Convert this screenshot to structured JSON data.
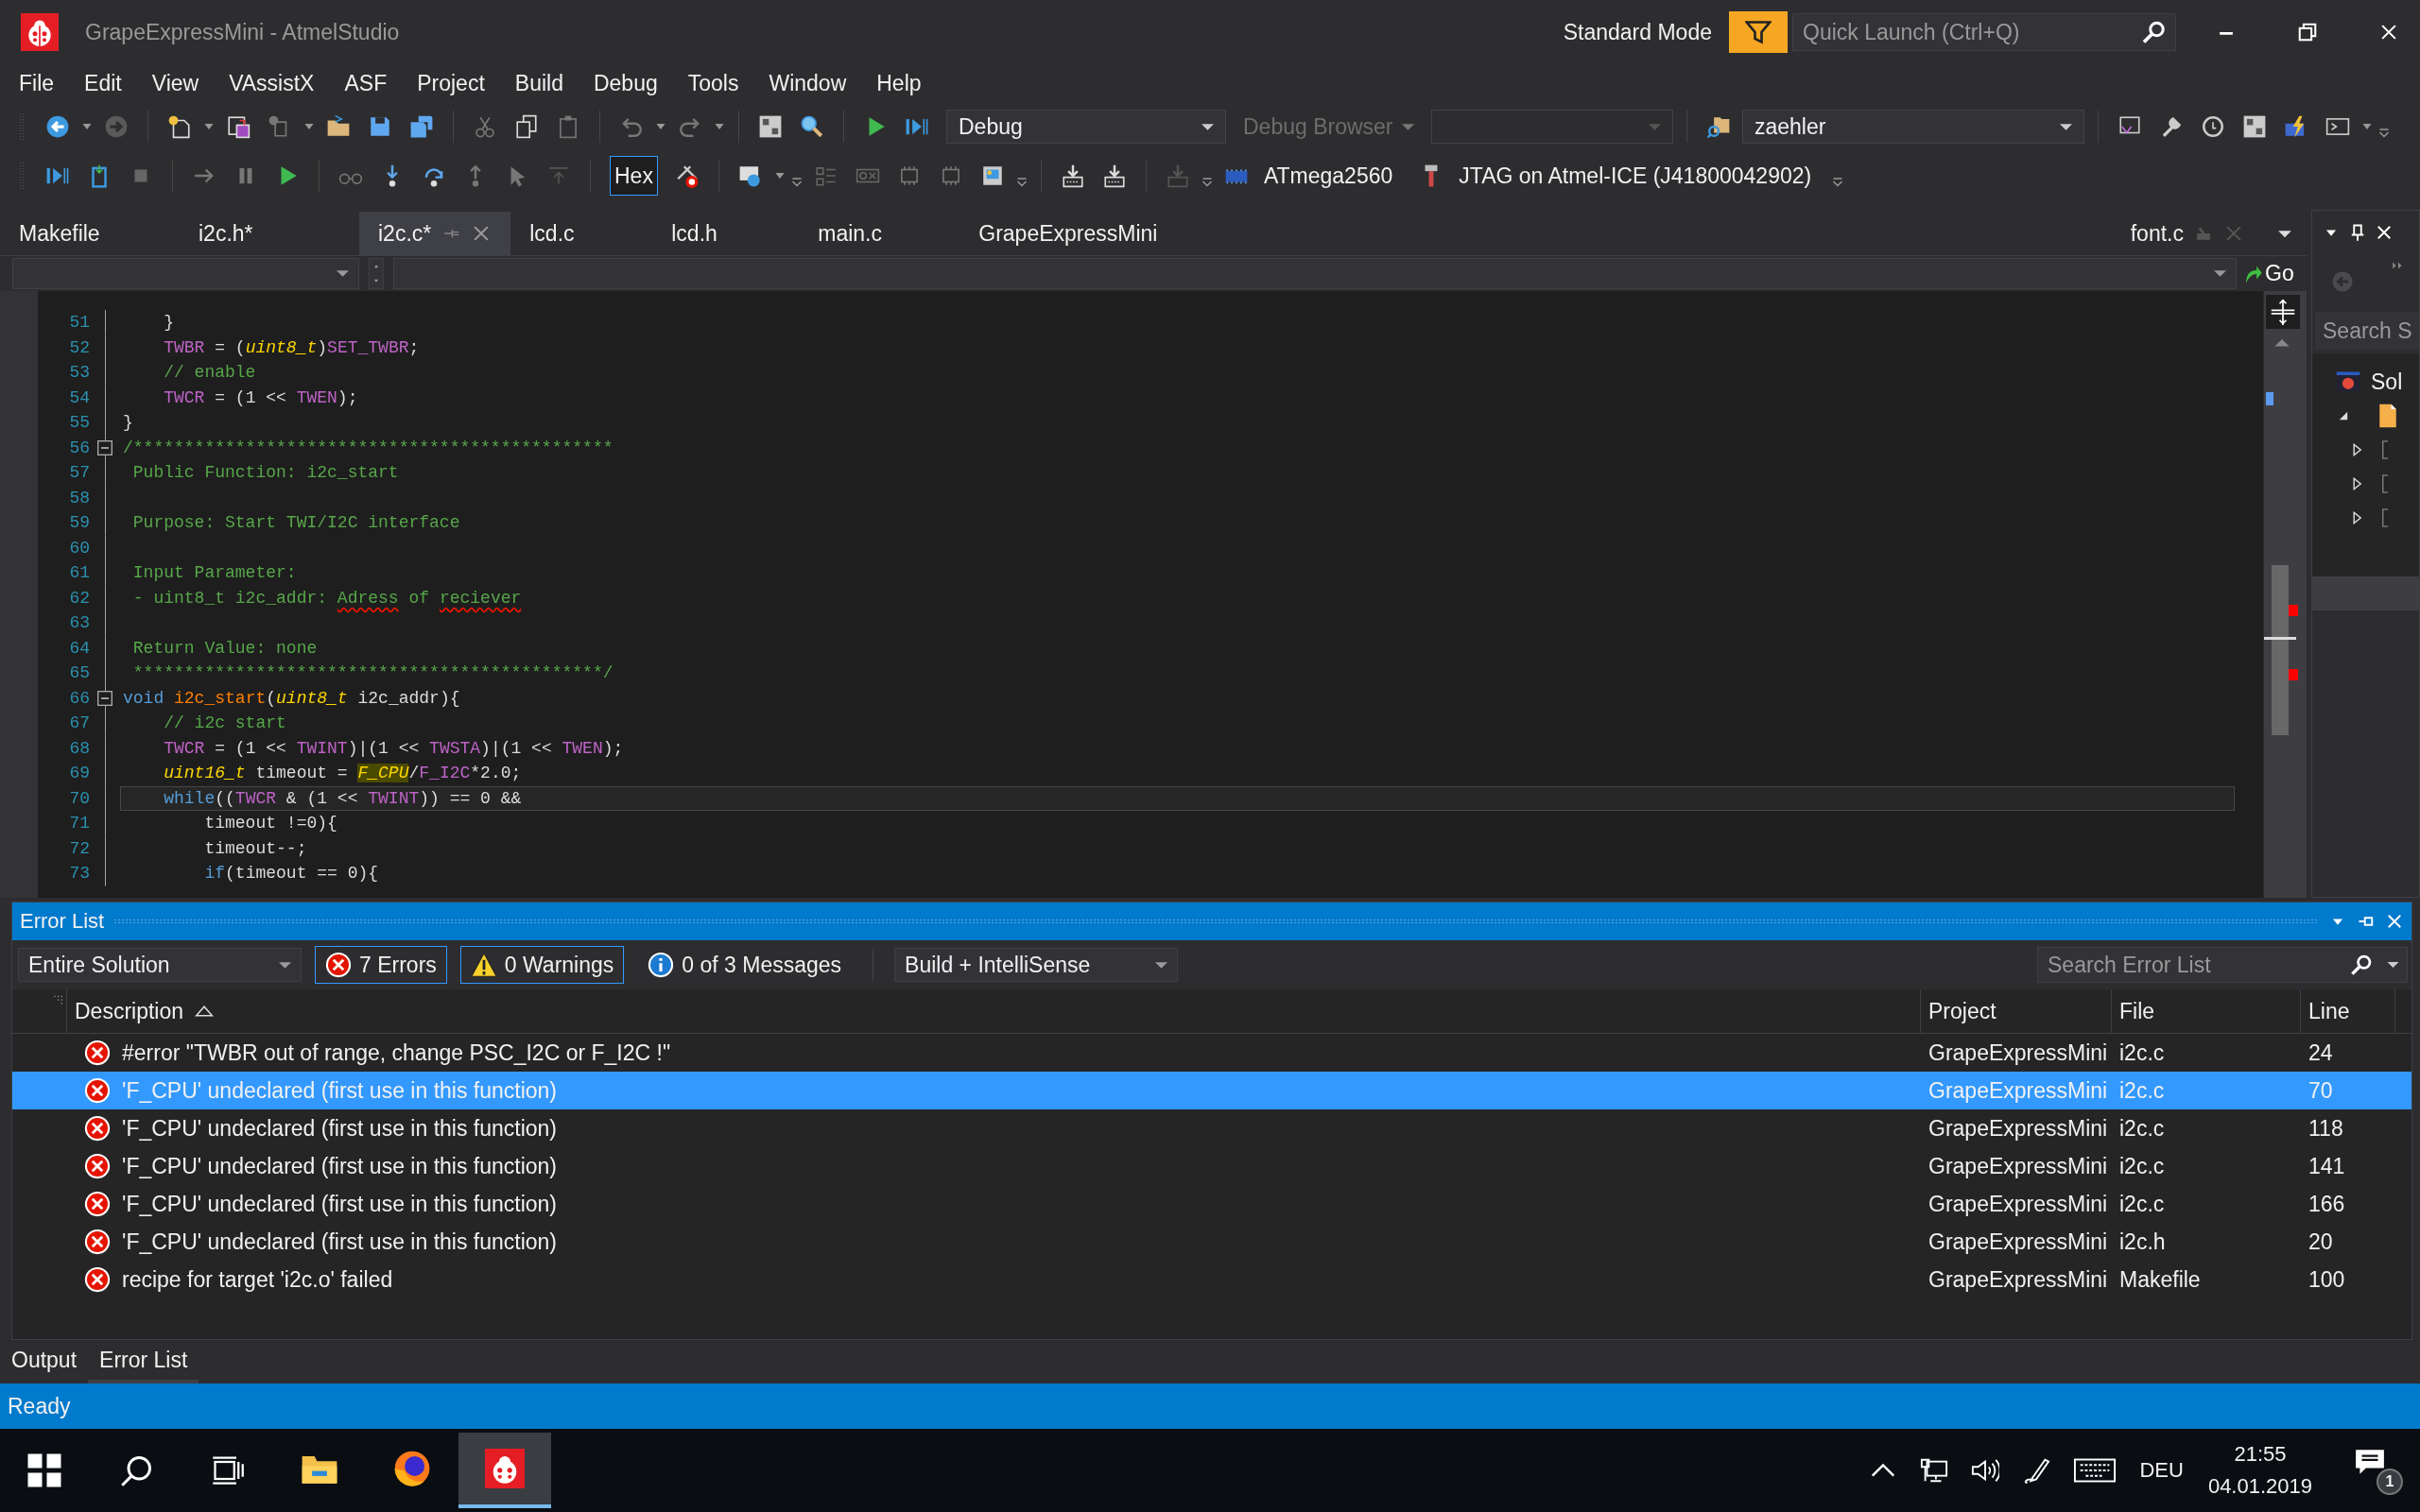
{
  "window": {
    "title": "GrapeExpressMini - AtmelStudio",
    "mode": "Standard Mode",
    "quick_launch": {
      "placeholder": "Quick Launch (Ctrl+Q)"
    }
  },
  "menu": [
    "File",
    "Edit",
    "View",
    "VAssistX",
    "ASF",
    "Project",
    "Build",
    "Debug",
    "Tools",
    "Window",
    "Help"
  ],
  "toolbar": {
    "configuration": "Debug",
    "debug_browser": {
      "label": "Debug Browser",
      "disabled": true
    },
    "project": "zaehler",
    "hex": {
      "label": "Hex",
      "on": true
    },
    "device": "ATmega2560",
    "tool": "JTAG on Atmel-ICE (J41800042902)"
  },
  "tabs": [
    {
      "label": "Makefile",
      "kind": "document",
      "selected": false
    },
    {
      "label": "i2c.h*",
      "kind": "document",
      "selected": false
    },
    {
      "label": "i2c.c*",
      "kind": "document",
      "selected": true
    },
    {
      "label": "lcd.c",
      "kind": "document",
      "selected": false
    },
    {
      "label": "lcd.h",
      "kind": "document",
      "selected": false
    },
    {
      "label": "main.c",
      "kind": "document",
      "selected": false
    },
    {
      "label": "GrapeExpressMini",
      "kind": "document",
      "selected": false
    },
    {
      "label": "font.c",
      "kind": "preview",
      "selected": false
    }
  ],
  "editor": {
    "go_button": "Go",
    "lines": [
      {
        "number": "51",
        "tokens": [
          {
            "kind": "plain",
            "text": "    }"
          }
        ]
      },
      {
        "number": "52",
        "tokens": [
          {
            "kind": "macro",
            "text": "    TWBR"
          },
          {
            "kind": "plain",
            "text": " = ("
          },
          {
            "kind": "type",
            "text": "uint8_t"
          },
          {
            "kind": "plain",
            "text": ")"
          },
          {
            "kind": "macro",
            "text": "SET_TWBR"
          },
          {
            "kind": "plain",
            "text": ";"
          }
        ]
      },
      {
        "number": "53",
        "tokens": [
          {
            "kind": "comment",
            "text": "    // enable"
          }
        ]
      },
      {
        "number": "54",
        "tokens": [
          {
            "kind": "macro",
            "text": "    TWCR"
          },
          {
            "kind": "plain",
            "text": " = (1 << "
          },
          {
            "kind": "macro",
            "text": "TWEN"
          },
          {
            "kind": "plain",
            "text": ");"
          }
        ]
      },
      {
        "number": "55",
        "tokens": [
          {
            "kind": "plain",
            "text": "}"
          }
        ]
      },
      {
        "number": "56",
        "fold": true,
        "tokens": [
          {
            "kind": "comment",
            "text": "/***********************************************"
          }
        ]
      },
      {
        "number": "57",
        "tokens": [
          {
            "kind": "comment",
            "text": " Public Function: i2c_start"
          }
        ]
      },
      {
        "number": "58"
      },
      {
        "number": "59",
        "tokens": [
          {
            "kind": "comment",
            "text": " Purpose: Start TWI/I2C interface"
          }
        ]
      },
      {
        "number": "60"
      },
      {
        "number": "61",
        "tokens": [
          {
            "kind": "comment",
            "text": " Input Parameter:"
          }
        ]
      },
      {
        "number": "62",
        "tokens": [
          {
            "kind": "comment",
            "text": " - uint8_t i2c_addr: "
          },
          {
            "kind": "misspelled",
            "text": "Adress"
          },
          {
            "kind": "comment",
            "text": " of "
          },
          {
            "kind": "misspelled",
            "text": "reciever"
          }
        ]
      },
      {
        "number": "63"
      },
      {
        "number": "64",
        "tokens": [
          {
            "kind": "comment",
            "text": " Return Value: none"
          }
        ]
      },
      {
        "number": "65",
        "tokens": [
          {
            "kind": "comment",
            "text": " **********************************************/"
          }
        ]
      },
      {
        "number": "66",
        "fold": true,
        "tokens": [
          {
            "kind": "keyword",
            "text": "void"
          },
          {
            "kind": "function",
            "text": " i2c_start"
          },
          {
            "kind": "plain",
            "text": "("
          },
          {
            "kind": "type",
            "text": "uint8_t"
          },
          {
            "kind": "plain",
            "text": " i2c_addr){"
          }
        ]
      },
      {
        "number": "67",
        "tokens": [
          {
            "kind": "comment",
            "text": "    // i2c start"
          }
        ]
      },
      {
        "number": "68",
        "tokens": [
          {
            "kind": "macro",
            "text": "    TWCR"
          },
          {
            "kind": "plain",
            "text": " = (1 << "
          },
          {
            "kind": "macro",
            "text": "TWINT"
          },
          {
            "kind": "plain",
            "text": ")|(1 << "
          },
          {
            "kind": "macro",
            "text": "TWSTA"
          },
          {
            "kind": "plain",
            "text": ")|(1 << "
          },
          {
            "kind": "macro",
            "text": "TWEN"
          },
          {
            "kind": "plain",
            "text": ");"
          }
        ]
      },
      {
        "number": "69",
        "tokens": [
          {
            "kind": "type",
            "text": "    uint16_t"
          },
          {
            "kind": "plain",
            "text": " timeout = "
          },
          {
            "kind": "highlight",
            "text": "F_CPU"
          },
          {
            "kind": "plain",
            "text": "/"
          },
          {
            "kind": "macro",
            "text": "F_I2C"
          },
          {
            "kind": "plain",
            "text": "*2.0;"
          }
        ]
      },
      {
        "number": "70",
        "current": true,
        "tokens": [
          {
            "kind": "keyword",
            "text": "    while"
          },
          {
            "kind": "plain",
            "text": "(("
          },
          {
            "kind": "macro",
            "text": "TWCR"
          },
          {
            "kind": "plain",
            "text": " & (1 << "
          },
          {
            "kind": "macro",
            "text": "TWINT"
          },
          {
            "kind": "plain",
            "text": ")) == 0 &&"
          }
        ]
      },
      {
        "number": "71",
        "tokens": [
          {
            "kind": "plain",
            "text": "        timeout !=0){"
          }
        ]
      },
      {
        "number": "72",
        "tokens": [
          {
            "kind": "plain",
            "text": "        timeout--;"
          }
        ]
      },
      {
        "number": "73",
        "tokens": [
          {
            "kind": "keyword",
            "text": "        if"
          },
          {
            "kind": "plain",
            "text": "(timeout == 0){"
          }
        ]
      }
    ]
  },
  "solution_explorer": {
    "search": {
      "placeholder": "Search S"
    },
    "tree": [
      {
        "label": "Sol",
        "children": [
          {
            "expanded": true,
            "children": [
              {
                "expanded": false
              },
              {
                "expanded": false
              },
              {
                "expanded": false
              }
            ]
          }
        ]
      }
    ]
  },
  "error_list": {
    "title": "Error List",
    "scope": "Entire Solution",
    "filters": [
      {
        "kind": "error",
        "label": "7 Errors",
        "selected": true
      },
      {
        "kind": "warning",
        "label": "0 Warnings",
        "selected": true
      },
      {
        "kind": "message",
        "label": "0 of 3 Messages",
        "selected": false
      }
    ],
    "source": "Build + IntelliSense",
    "search": {
      "placeholder": "Search Error List"
    },
    "columns": [
      {
        "label": "Description",
        "sorted": true
      },
      {
        "label": "Project",
        "sorted": false
      },
      {
        "label": "File",
        "sorted": false
      },
      {
        "label": "Line",
        "sorted": false
      }
    ],
    "rows": [
      {
        "description": "#error \"TWBR out of range, change PSC_I2C or F_I2C !\"",
        "project": "GrapeExpressMini",
        "file": "i2c.c",
        "line": "24",
        "selected": false
      },
      {
        "description": "'F_CPU' undeclared (first use in this function)",
        "project": "GrapeExpressMini",
        "file": "i2c.c",
        "line": "70",
        "selected": true
      },
      {
        "description": "'F_CPU' undeclared (first use in this function)",
        "project": "GrapeExpressMini",
        "file": "i2c.c",
        "line": "118",
        "selected": false
      },
      {
        "description": "'F_CPU' undeclared (first use in this function)",
        "project": "GrapeExpressMini",
        "file": "i2c.c",
        "line": "141",
        "selected": false
      },
      {
        "description": "'F_CPU' undeclared (first use in this function)",
        "project": "GrapeExpressMini",
        "file": "i2c.c",
        "line": "166",
        "selected": false
      },
      {
        "description": "'F_CPU' undeclared (first use in this function)",
        "project": "GrapeExpressMini",
        "file": "i2c.h",
        "line": "20",
        "selected": false
      },
      {
        "description": "recipe for target 'i2c.o' failed",
        "project": "GrapeExpressMini",
        "file": "Makefile",
        "line": "100",
        "selected": false
      }
    ]
  },
  "panel_tabs": [
    {
      "label": "Output",
      "selected": false
    },
    {
      "label": "Error List",
      "selected": true
    }
  ],
  "status_bar": "Ready",
  "taskbar": {
    "apps": [
      {
        "kind": "explorer",
        "selected": false
      },
      {
        "kind": "firefox",
        "selected": false
      },
      {
        "kind": "atmel",
        "selected": true
      }
    ],
    "language": "DEU",
    "time": "21:55",
    "date": "04.01.2019",
    "notifications": "1"
  }
}
